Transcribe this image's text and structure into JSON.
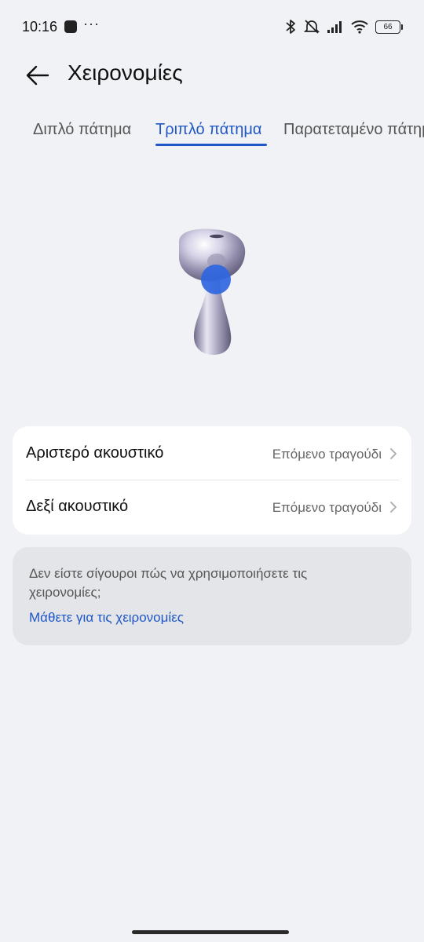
{
  "status_bar": {
    "time": "10:16",
    "more_dots": "···",
    "battery_level": "66",
    "icons": [
      "app-notification-icon",
      "bluetooth-icon",
      "mute-icon",
      "signal-icon",
      "wifi-icon",
      "battery-icon"
    ]
  },
  "header": {
    "title": "Χειρονομίες",
    "back_icon": "arrow-left-icon"
  },
  "tabs": [
    {
      "label": "Διπλό πάτημα",
      "active": false
    },
    {
      "label": "Τριπλό πάτημα",
      "active": true
    },
    {
      "label": "Παρατεταμένο πάτημα",
      "active": false
    }
  ],
  "illustration": {
    "name": "earbud-illustration"
  },
  "settings": [
    {
      "label": "Αριστερό ακουστικό",
      "value": "Επόμενο τραγούδι"
    },
    {
      "label": "Δεξί ακουστικό",
      "value": "Επόμενο τραγούδι"
    }
  ],
  "help": {
    "text": "Δεν είστε σίγουροι πώς να χρησιμοποιήσετε τις χειρονομίες;",
    "link": "Μάθετε για τις χειρονομίες"
  },
  "colors": {
    "accent": "#1f57c7",
    "background": "#f1f2f5",
    "card": "#ffffff",
    "help_card": "#e4e5e8"
  }
}
